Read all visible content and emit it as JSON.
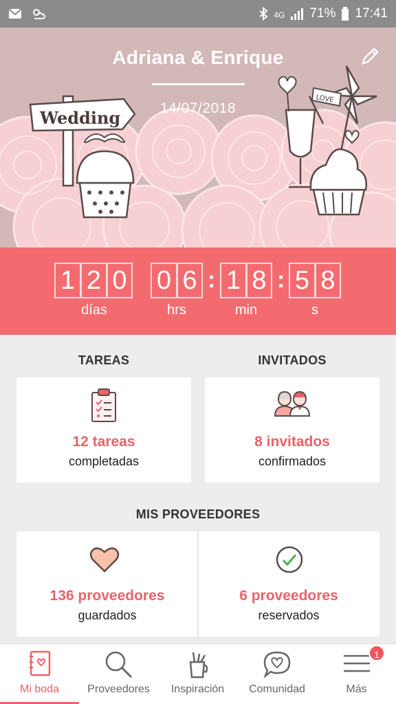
{
  "status_bar": {
    "network": "4G",
    "battery": "71%",
    "time": "17:41",
    "icons": [
      "mail-icon",
      "weather-icon",
      "bluetooth-icon",
      "signal-icon",
      "battery-icon"
    ]
  },
  "hero": {
    "title": "Adriana & Enrique",
    "date": "14/07/2018",
    "sign_text": "Wedding",
    "flag_text": "LOVE"
  },
  "countdown": {
    "days": [
      "1",
      "2",
      "0"
    ],
    "hours": [
      "0",
      "6"
    ],
    "minutes": [
      "1",
      "8"
    ],
    "seconds": [
      "5",
      "8"
    ],
    "labels": {
      "days": "días",
      "hours": "hrs",
      "minutes": "min",
      "seconds": "s"
    }
  },
  "tasks": {
    "title": "TAREAS",
    "value": "12 tareas",
    "caption": "completadas"
  },
  "guests": {
    "title": "INVITADOS",
    "value": "8 invitados",
    "caption": "confirmados"
  },
  "vendors": {
    "title": "MIS PROVEEDORES",
    "saved_value": "136 proveedores",
    "saved_caption": "guardados",
    "booked_value": "6 proveedores",
    "booked_caption": "reservados"
  },
  "nav": {
    "items": [
      {
        "label": "Mi boda",
        "icon": "notebook-icon",
        "active": true
      },
      {
        "label": "Proveedores",
        "icon": "search-icon"
      },
      {
        "label": "Inspiración",
        "icon": "pencil-cup-icon"
      },
      {
        "label": "Comunidad",
        "icon": "chat-heart-icon"
      },
      {
        "label": "Más",
        "icon": "menu-icon"
      }
    ],
    "badge": "1"
  },
  "colors": {
    "accent": "#e8636b",
    "countdown_bg": "#f46b6f",
    "hero_bg": "#d3b8b8",
    "status_bar": "#8b8b8b"
  }
}
